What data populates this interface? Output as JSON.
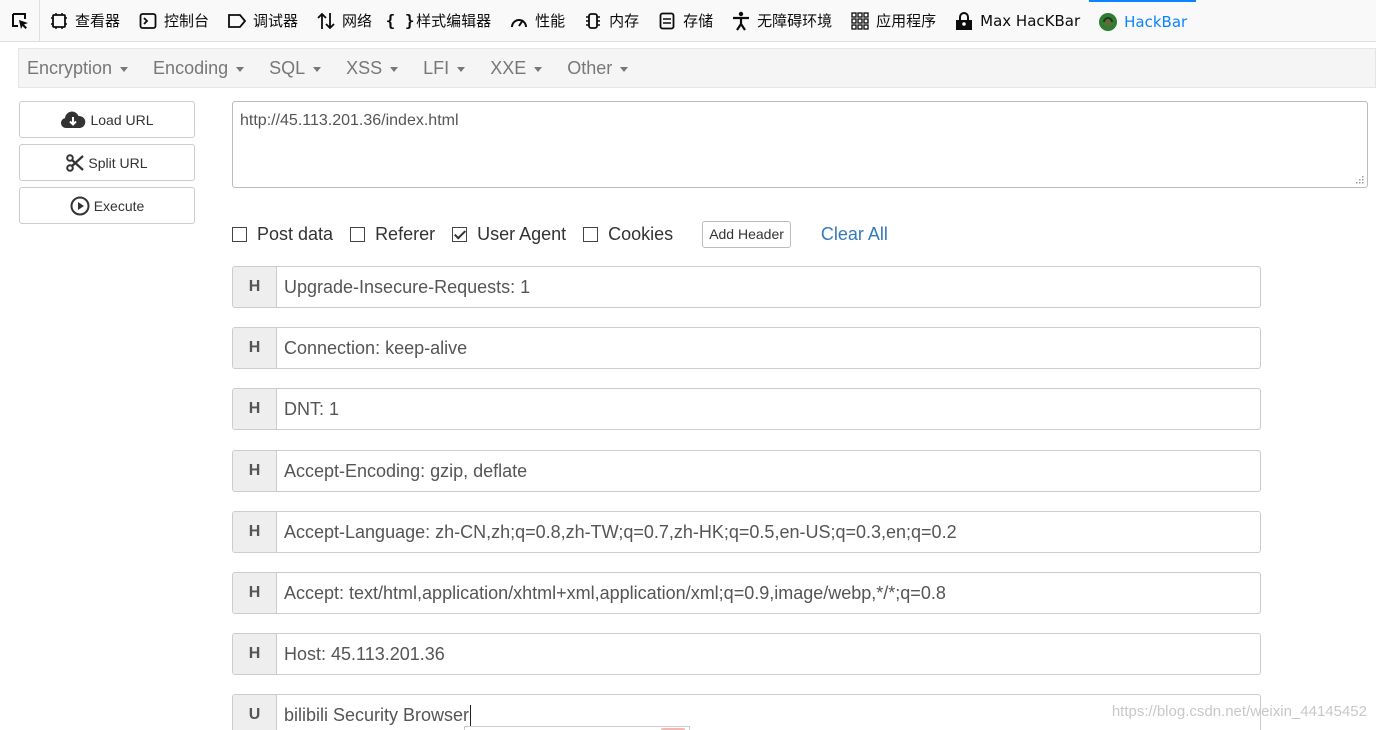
{
  "devtools": {
    "tabs": [
      {
        "label": "查看器",
        "icon": "inspector-icon"
      },
      {
        "label": "控制台",
        "icon": "console-icon"
      },
      {
        "label": "调试器",
        "icon": "debugger-icon"
      },
      {
        "label": "网络",
        "icon": "network-icon"
      },
      {
        "label": "样式编辑器",
        "icon": "style-editor-icon"
      },
      {
        "label": "性能",
        "icon": "performance-icon"
      },
      {
        "label": "内存",
        "icon": "memory-icon"
      },
      {
        "label": "存储",
        "icon": "storage-icon"
      },
      {
        "label": "无障碍环境",
        "icon": "accessibility-icon"
      },
      {
        "label": "应用程序",
        "icon": "application-icon"
      },
      {
        "label": "Max HacKBar",
        "icon": "max-hackbar-icon"
      },
      {
        "label": "HackBar",
        "icon": "hackbar-icon"
      }
    ],
    "active_tab": "HackBar",
    "accent": "#0a84ff"
  },
  "menu": {
    "items": [
      "Encryption",
      "Encoding",
      "SQL",
      "XSS",
      "LFI",
      "XXE",
      "Other"
    ]
  },
  "actions": {
    "load_url": "Load URL",
    "split_url": "Split URL",
    "execute": "Execute"
  },
  "url": {
    "value": "http://45.113.201.36/index.html"
  },
  "options": {
    "post_data": {
      "label": "Post data",
      "checked": false
    },
    "referer": {
      "label": "Referer",
      "checked": false
    },
    "user_agent": {
      "label": "User Agent",
      "checked": true
    },
    "cookies": {
      "label": "Cookies",
      "checked": false
    },
    "add_header": "Add Header",
    "clear_all": "Clear All",
    "link_color": "#337ab7"
  },
  "headers": [
    {
      "tag": "H",
      "value": "Upgrade-Insecure-Requests: 1"
    },
    {
      "tag": "H",
      "value": "Connection: keep-alive"
    },
    {
      "tag": "H",
      "value": "DNT: 1"
    },
    {
      "tag": "H",
      "value": "Accept-Encoding: gzip, deflate"
    },
    {
      "tag": "H",
      "value": "Accept-Language: zh-CN,zh;q=0.8,zh-TW;q=0.7,zh-HK;q=0.5,en-US;q=0.3,en;q=0.2"
    },
    {
      "tag": "H",
      "value": "Accept: text/html,application/xhtml+xml,application/xml;q=0.9,image/webp,*/*;q=0.8"
    },
    {
      "tag": "H",
      "value": "Host: 45.113.201.36"
    },
    {
      "tag": "U",
      "value": "bilibili Security Browser"
    }
  ],
  "watermark": "https://blog.csdn.net/weixin_44145452"
}
